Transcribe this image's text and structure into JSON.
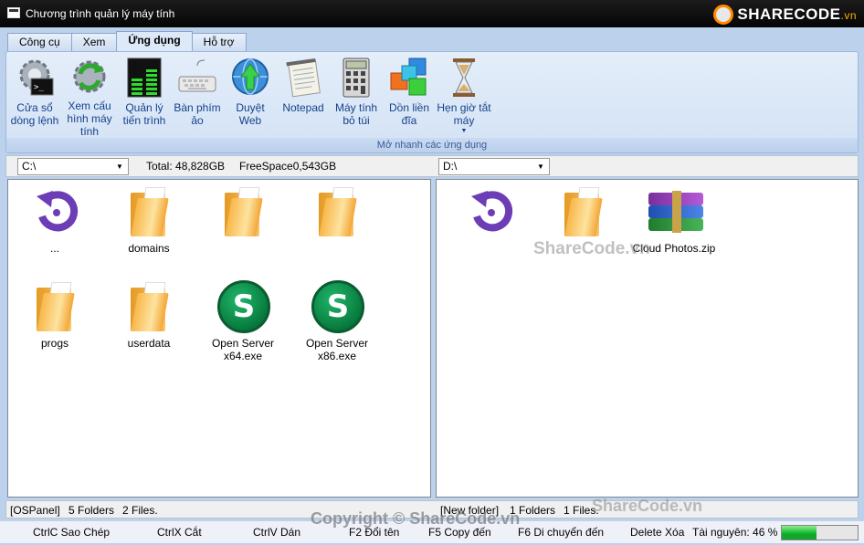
{
  "window": {
    "title": "Chương trình quản lý máy tính"
  },
  "logo": {
    "text": "SHARECODE",
    "suffix": ".vn"
  },
  "tabs": [
    "Công cụ",
    "Xem",
    "Ứng dụng",
    "Hỗ trợ"
  ],
  "active_tab": "Ứng dụng",
  "ribbon": {
    "items": [
      {
        "label": "Cửa sổ dòng lệnh",
        "icon": "command-prompt-gear-icon"
      },
      {
        "label": "Xem cấu hình máy tính",
        "icon": "refresh-gear-icon"
      },
      {
        "label": "Quản lý tiến trình",
        "icon": "process-meter-icon"
      },
      {
        "label": "Bàn phím ảo",
        "icon": "keyboard-icon"
      },
      {
        "label": "Duyệt Web",
        "icon": "web-globe-icon"
      },
      {
        "label": "Notepad",
        "icon": "notepad-icon"
      },
      {
        "label": "Máy tính bỏ túi",
        "icon": "calculator-icon"
      },
      {
        "label": "Dồn liền đĩa",
        "icon": "defrag-cubes-icon"
      },
      {
        "label": "Hẹn giờ tắt máy",
        "icon": "hourglass-icon"
      }
    ],
    "group_label": "Mở nhanh các ứng dụng"
  },
  "left": {
    "path": "C:\\",
    "total": "Total: 48,828GB",
    "freespace": "FreeSpace0,543GB",
    "items": [
      {
        "label": "...",
        "type": "up"
      },
      {
        "label": "domains",
        "type": "folder"
      },
      {
        "label": "",
        "type": "folder"
      },
      {
        "label": "",
        "type": "folder"
      },
      {
        "label": "progs",
        "type": "folder"
      },
      {
        "label": "userdata",
        "type": "folder"
      },
      {
        "label": "Open Server x64.exe",
        "type": "exe"
      },
      {
        "label": "Open Server x86.exe",
        "type": "exe"
      }
    ],
    "status": {
      "path": "[OSPanel]",
      "folders": "5 Folders",
      "files": "2 Files."
    }
  },
  "right": {
    "path": "D:\\",
    "items": [
      {
        "label": "",
        "type": "up"
      },
      {
        "label": "",
        "type": "folder"
      },
      {
        "label": "Cloud Photos.zip",
        "type": "zip"
      }
    ],
    "status": {
      "path": "[New folder]",
      "folders": "1 Folders",
      "files": "1 Files."
    }
  },
  "commands": {
    "copy": "CtrlC Sao Chép",
    "cut": "CtrlX Cắt",
    "paste": "CtrlV Dán",
    "rename": "F2 Đổi tên",
    "copyto": "F5 Copy đến",
    "moveto": "F6 Di chuyển đến",
    "delete": "Delete  Xóa",
    "resource": "Tài nguyên: 46 %"
  },
  "resource_level": 0.46,
  "watermarks": {
    "center": "ShareCode.vn",
    "bottom_right": "ShareCode.vn",
    "copyright": "Copyright © ShareCode.vn"
  },
  "colors": {
    "accent": "#15428b",
    "progress": "#06b025",
    "title_bar": "#0a0a0a",
    "logo_orange": "#ff8a00"
  }
}
